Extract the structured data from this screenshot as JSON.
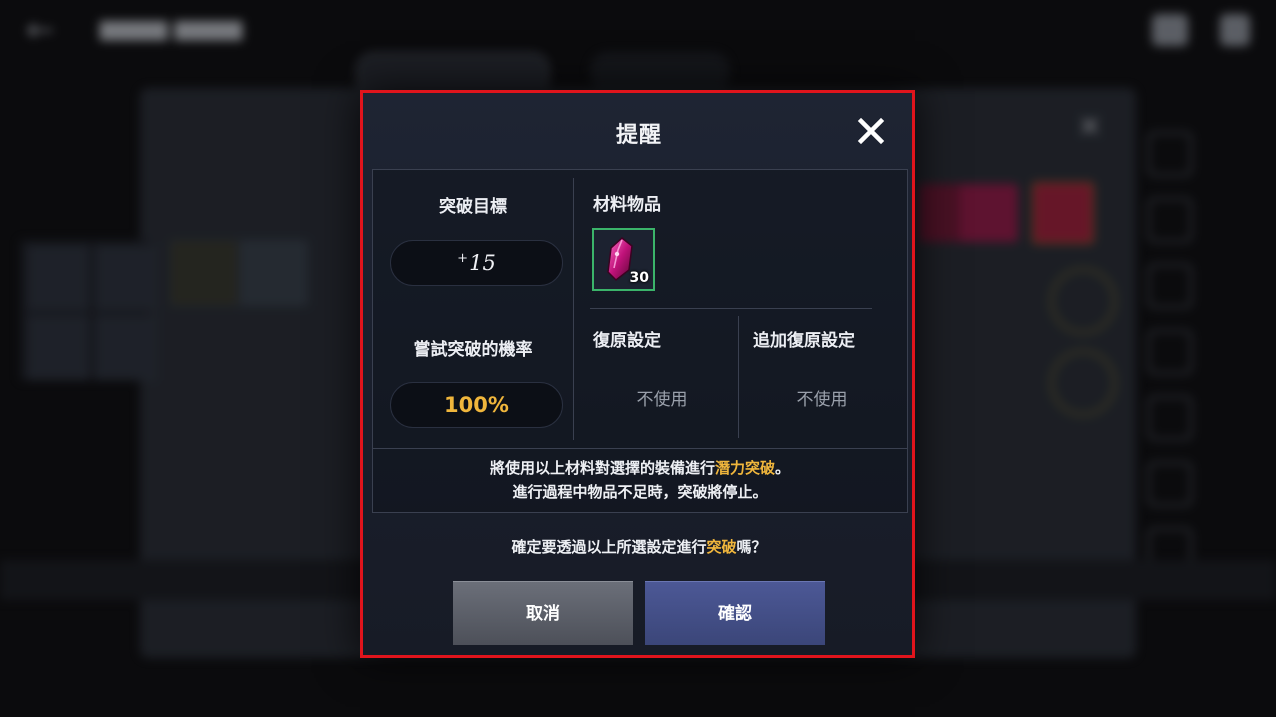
{
  "dialog": {
    "title": "提醒",
    "target_label": "突破目標",
    "target_value": "15",
    "target_prefix": "+",
    "rate_label": "嘗試突破的機率",
    "rate_value": "100%",
    "material_label": "材料物品",
    "material_item": {
      "icon": "magenta-crystal-icon",
      "count": "30"
    },
    "restore_label": "復原設定",
    "restore_value": "不使用",
    "extra_restore_label": "追加復原設定",
    "extra_restore_value": "不使用",
    "notice_line1_prefix": "將使用以上材料對選擇的裝備進行",
    "notice_line1_highlight": "潛力突破",
    "notice_line1_suffix": "。",
    "notice_line2": "進行過程中物品不足時，突破將停止。",
    "confirm_prefix": "確定要透過以上所選設定進行",
    "confirm_highlight": "突破",
    "confirm_suffix": "嗎？",
    "cancel_label": "取消",
    "ok_label": "確認"
  },
  "colors": {
    "highlight": "#f0b63c",
    "border_highlight": "#e0141c",
    "slot_border": "#3bb46a",
    "cancel_button": "#5b5e67",
    "ok_button": "#434f88"
  }
}
